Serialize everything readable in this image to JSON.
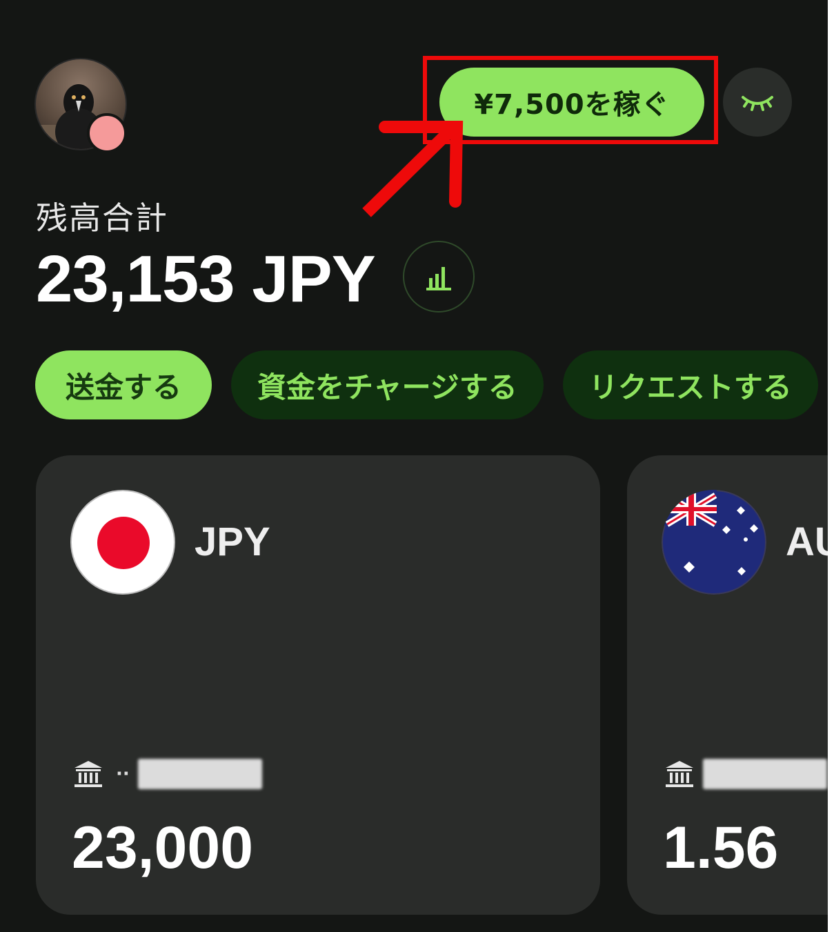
{
  "header": {
    "earn_button_label": "¥7,500を稼ぐ"
  },
  "balance": {
    "label": "残高合計",
    "amount": "23,153 JPY"
  },
  "actions": [
    {
      "label": "送金する"
    },
    {
      "label": "資金をチャージする"
    },
    {
      "label": "リクエストする"
    }
  ],
  "accounts": [
    {
      "code": "JPY",
      "masked_prefix": "··",
      "amount": "23,000"
    },
    {
      "code": "AU",
      "masked_prefix": "",
      "amount": "1.56"
    }
  ],
  "colors": {
    "background": "#141614",
    "accent_green": "#8fe45f",
    "dark_green": "#0f300f",
    "card": "#2a2c2a",
    "annotation_red": "#ee0a0a"
  }
}
